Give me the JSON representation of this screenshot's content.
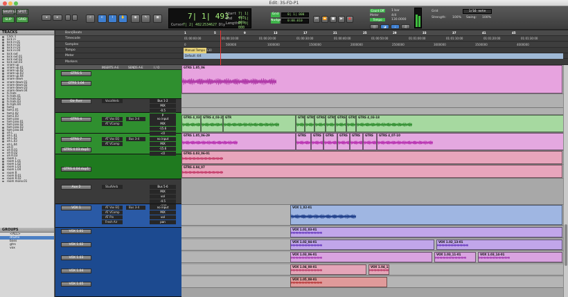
{
  "window": {
    "title": "Edit: 3S-FD-P1"
  },
  "toolbar": {
    "modes": [
      "SHUFFLE",
      "SPOT",
      "SLIP",
      "GRID"
    ],
    "main_counter": "7| 1| 493",
    "cursor_label": "Cursor",
    "cursor_value": "7| 2| 482",
    "cursor_sample": "2534627",
    "dly_label": "Dly",
    "start_label": "Start",
    "start_value": "7| 1| 493",
    "end_label": "End",
    "end_value": "7| 1| 069",
    "length_label": "Length",
    "length_value": "0| 0| 000",
    "grid_label": "Grid",
    "grid_value": "0| 1| 000",
    "nudge_label": "Nudge",
    "nudge_value": "0:00.010",
    "countoff": "Count Off",
    "meter_label": "Meter",
    "tempo_label": "Tempo",
    "meter_value": "4/4",
    "bars": "1 bar",
    "tempo_value": "130.0000",
    "grid_right": "Grid",
    "note_value": "1/16 note",
    "strength_label": "Strength:",
    "strength_value": "100%",
    "swing_label": "Swing:",
    "swing_value": "100%"
  },
  "tracks_panel": {
    "header": "TRACKS",
    "items": [
      "Click 1",
      "kick in",
      "kick in.01",
      "kick in.02",
      "kick in.03",
      "kick in.04",
      "kick out",
      "kick out.01",
      "kick out.02",
      "kick out.03",
      "snare up",
      "snare up.01",
      "snare up.02",
      "snare up.03",
      "snare up.04",
      "snare down",
      "snare down.01",
      "snare down.02",
      "snare down.03",
      "snare down.04",
      "hi hats",
      "hi hats.01",
      "hi hats.02",
      "hi hats.03",
      "hi hats.04",
      "tom1",
      "tom1.01",
      "tom1.02",
      "tom1.03",
      "tom piso",
      "tom piso.01",
      "tom piso.02",
      "tom piso.03",
      "tom piso.04",
      "oh L",
      "oh L.01",
      "oh L.02",
      "oh L.03",
      "oh L.04",
      "oh R",
      "oh R.01",
      "oh R.02",
      "oh R.03",
      "room L",
      "room L.01",
      "room L.02",
      "room L.03",
      "room L.04",
      "room R",
      "room R.01",
      "room R.02",
      "room mono.01"
    ]
  },
  "groups_panel": {
    "header": "GROUPS",
    "items": [
      "<ALL>",
      "drums",
      "bass",
      "gtrs",
      "vox"
    ]
  },
  "ruler": {
    "rows": [
      "Bars|Beats",
      "Timecode",
      "Samples",
      "Tempo",
      "Meter",
      "Markers"
    ],
    "bars": [
      "1",
      "5",
      "9",
      "13",
      "17",
      "21",
      "25",
      "29",
      "33",
      "37",
      "41",
      "45"
    ],
    "timecode": [
      "01:00:00:00",
      "01:00:10:00",
      "01:00:20:00",
      "01:00:30:00",
      "01:00:40:00",
      "01:00:50:00",
      "01:01:00:00",
      "01:01:10:00",
      "01:01:20:00",
      "01:01:30:00"
    ],
    "samples": [
      "0",
      "500000",
      "1000000",
      "1500000",
      "2000000",
      "2500000",
      "3000000",
      "3500000",
      "4000000"
    ],
    "tempo_text": "Manual Tempo",
    "tempo_val": "130",
    "meter_text": "Default: 4/4"
  },
  "column_headers": {
    "inserts": "INSERTS A-E",
    "sends": "SENDS A-E",
    "io": "I / O"
  },
  "mix_tracks": [
    {
      "name": "GTRS 5",
      "inserts": [],
      "sends": [],
      "io": []
    },
    {
      "name": "GTRS 1.04",
      "inserts": [],
      "sends": [],
      "io": []
    },
    {
      "name": "Gtr Rvrr",
      "inserts": [
        "VocalVerb"
      ],
      "sends": [],
      "io": [
        "Bus 1-2",
        "MIX",
        "-0.5",
        "P",
        "P"
      ]
    },
    {
      "name": "GTRS 4",
      "inserts": [
        "AT Vox EQ",
        "AT VComp"
      ],
      "sends": [
        "Bus 3-4"
      ],
      "io": [
        "no input",
        "MIX",
        "-15.6",
        "<0"
      ]
    },
    {
      "name": "GTRS 7",
      "inserts": [
        "AT Vox EQ",
        "AT VComp"
      ],
      "sends": [
        "Bus 3-4"
      ],
      "io": [
        "no input",
        "MIX",
        "-15.6",
        "<0"
      ]
    },
    {
      "name": "GTRS 4.03.dup1",
      "inserts": [],
      "sends": [],
      "io": []
    },
    {
      "name": "GTRS 4.04.dup1",
      "inserts": [],
      "sends": [],
      "io": []
    },
    {
      "name": "Aux 2",
      "inserts": [
        "StudVerb"
      ],
      "sends": [],
      "io": [
        "Bus 5-6",
        "MIX",
        "vol",
        "-4.5",
        "<100"
      ]
    },
    {
      "name": "VOX 1",
      "inserts": [
        "AT Vox EQ",
        "AT VComp",
        "AT Pin",
        "Fresh Air"
      ],
      "sends": [
        "Bus 3-4"
      ],
      "io": [
        "no input",
        "MIX",
        "vol",
        "pan"
      ]
    },
    {
      "name": "VOX 1.01",
      "inserts": [],
      "sends": [],
      "io": []
    },
    {
      "name": "VOX 1.02",
      "inserts": [],
      "sends": [],
      "io": []
    },
    {
      "name": "VOX 1.03",
      "inserts": [],
      "sends": [],
      "io": []
    },
    {
      "name": "VOX 1.04",
      "inserts": [],
      "sends": [],
      "io": []
    },
    {
      "name": "VOX 1.05",
      "inserts": [],
      "sends": [],
      "io": []
    }
  ],
  "clips": {
    "gtrs5": "GTRS 1.05_06",
    "gtrs4": [
      "GTRS 4_03-22",
      "GTRS 4_03-25",
      "GTR",
      "GTRS",
      "GTRS",
      "GTRS",
      "GTRS",
      "GTRS",
      "GTRS",
      "GTRS 4_03-18"
    ],
    "gtrs7": [
      "GTRS 1.05_06-29",
      "GTRS",
      "GTRS",
      "GTRS",
      "GTRS",
      "GTRS",
      "GTRS",
      "GTRS 4_07-10"
    ],
    "gtrs403": "GTRS 4.03_06-01",
    "gtrs404": "GTRS 4.04_07",
    "vox1": "VOX 1_02-01",
    "vox101": "VOX 1.01_03-01",
    "vox102": [
      "VOX 1.02_04-01",
      "VOX 1.02_13-01"
    ],
    "vox103": [
      "VOX 1.03_06-01",
      "VOX 1.03_11-01",
      "VOX 1.03_14-01"
    ],
    "vox104": [
      "VOX 1.04_08-01",
      "VOX 1.04_12-01"
    ],
    "vox105": "VOX 1.05_08-01"
  },
  "colors": {
    "green": "#3fa43f",
    "pink": "#e7a3df",
    "magenta": "#d04fc9",
    "red": "#d0465f",
    "blue": "#3a63b8",
    "purple": "#8a5ed8"
  }
}
